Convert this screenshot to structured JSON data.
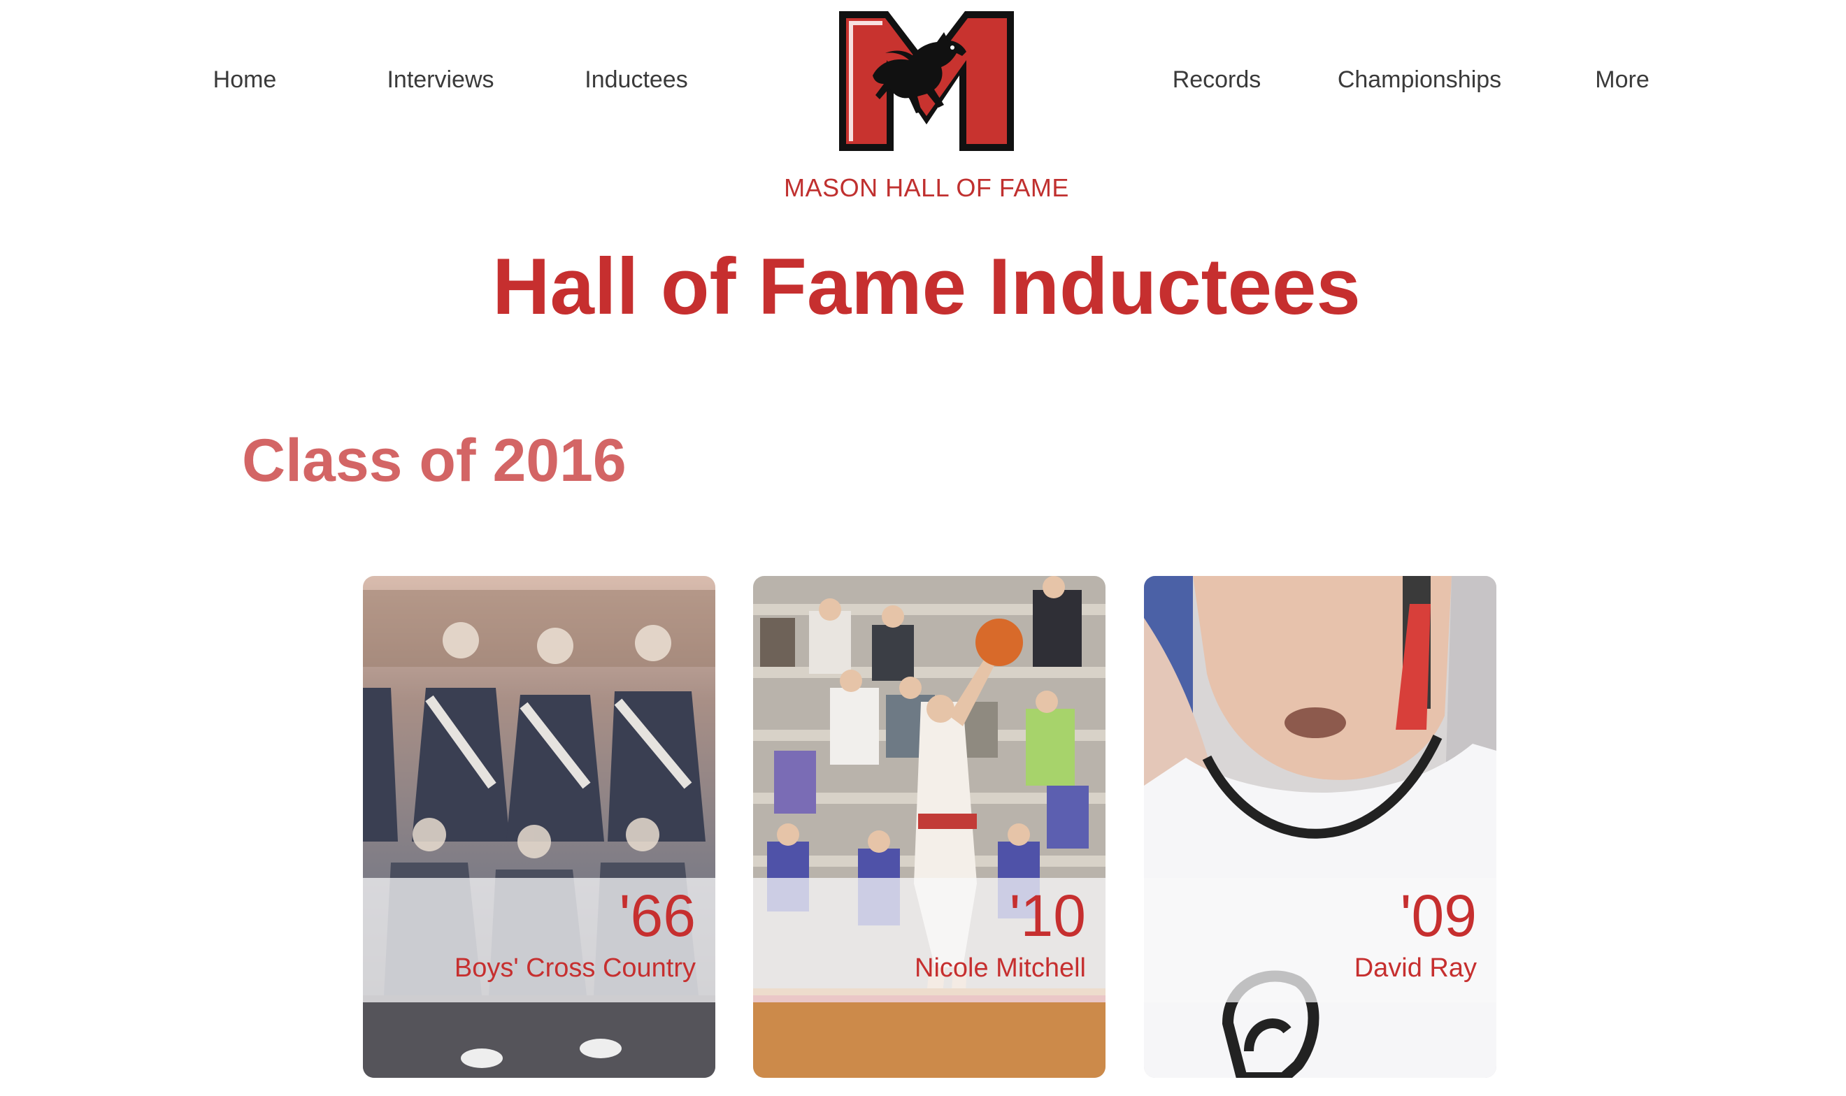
{
  "nav": {
    "left": [
      "Home",
      "Interviews",
      "Inductees"
    ],
    "right": [
      "Records",
      "Championships",
      "More"
    ]
  },
  "logo": {
    "icon": "mustang-m-logo",
    "colors": {
      "red": "#c8332f",
      "black": "#111111"
    }
  },
  "site_name": "MASON HALL OF FAME",
  "page_title": "Hall of Fame Inductees",
  "class_heading": "Class of 2016",
  "inductees": [
    {
      "year": "'66",
      "name": "Boys' Cross Country",
      "photo": "team-photo"
    },
    {
      "year": "'10",
      "name": "Nicole Mitchell",
      "photo": "basketball-photo"
    },
    {
      "year": "'09",
      "name": "David Ray",
      "photo": "wrestler-photo"
    }
  ],
  "colors": {
    "accent": "#c62f2f",
    "heading_light": "#d36565",
    "nav_text": "#3a3a3a"
  }
}
